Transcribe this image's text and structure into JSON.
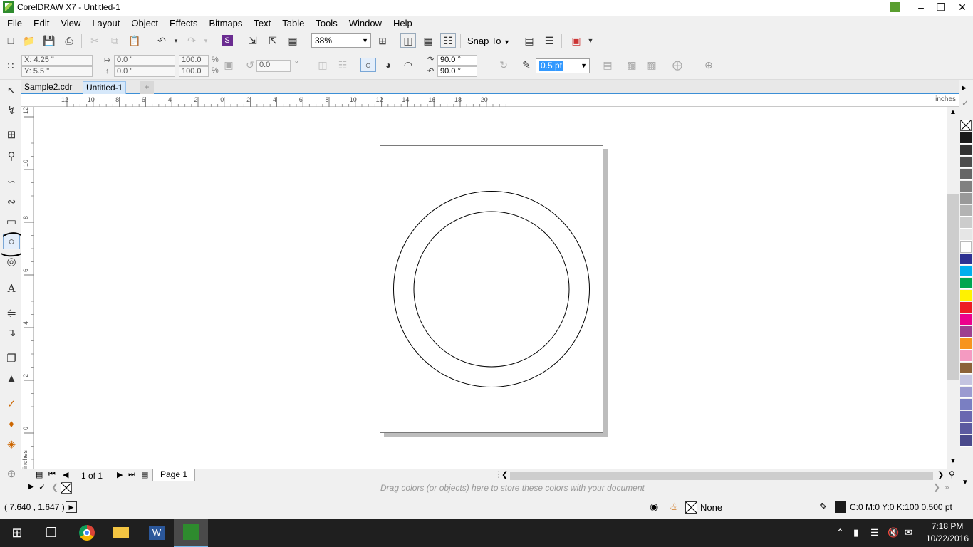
{
  "window": {
    "title": "CorelDRAW X7 - Untitled-1"
  },
  "menu": [
    "File",
    "Edit",
    "View",
    "Layout",
    "Object",
    "Effects",
    "Bitmaps",
    "Text",
    "Table",
    "Tools",
    "Window",
    "Help"
  ],
  "toolbar": {
    "zoom": "38%",
    "snap_to": "Snap To"
  },
  "propbar": {
    "x": "X: 4.25 \"",
    "y": "Y: 5.5 \"",
    "width": "0.0 \"",
    "height": "0.0 \"",
    "scale_w": "100.0",
    "scale_h": "100.0",
    "pct": "%",
    "rotation": "0.0",
    "deg": "°",
    "start_angle": "90.0 °",
    "end_angle": "90.0 °",
    "outline_width": "0.5 pt"
  },
  "doc_tabs": [
    "Sample2.cdr",
    "Untitled-1"
  ],
  "ruler": {
    "h_labels": [
      "12",
      "10",
      "8",
      "6",
      "4",
      "2",
      "0",
      "2",
      "4",
      "6",
      "8",
      "10",
      "12",
      "14",
      "16",
      "18",
      "20"
    ],
    "h_units": "inches",
    "v_labels": [
      "12",
      "10",
      "8",
      "6",
      "4",
      "2",
      "0"
    ],
    "v_units": "inches"
  },
  "page_nav": {
    "page_count": "1 of 1",
    "page_tab": "Page 1"
  },
  "doc_palette": {
    "hint": "Drag colors (or objects) here to store these colors with your document"
  },
  "status": {
    "coords": "( 7.640 , 1.647 )",
    "fill": "None",
    "outline": "C:0 M:0 Y:0 K:100  0.500 pt"
  },
  "palette_colors": [
    "#1a1a1a",
    "#333333",
    "#4d4d4d",
    "#666666",
    "#808080",
    "#999999",
    "#b3b3b3",
    "#cccccc",
    "#e6e6e6",
    "#ffffff",
    "#2e3192",
    "#00aeef",
    "#00a651",
    "#fff200",
    "#ed1c24",
    "#ec008c",
    "#9e3f8f",
    "#f7941d",
    "#f49ac1",
    "#8c6239",
    "#c4c4e0",
    "#9b9bd0",
    "#7a7fc2",
    "#6a67b0",
    "#5b5aa0",
    "#4a4a8c"
  ],
  "taskbar": {
    "time": "7:18 PM",
    "date": "10/22/2016"
  }
}
